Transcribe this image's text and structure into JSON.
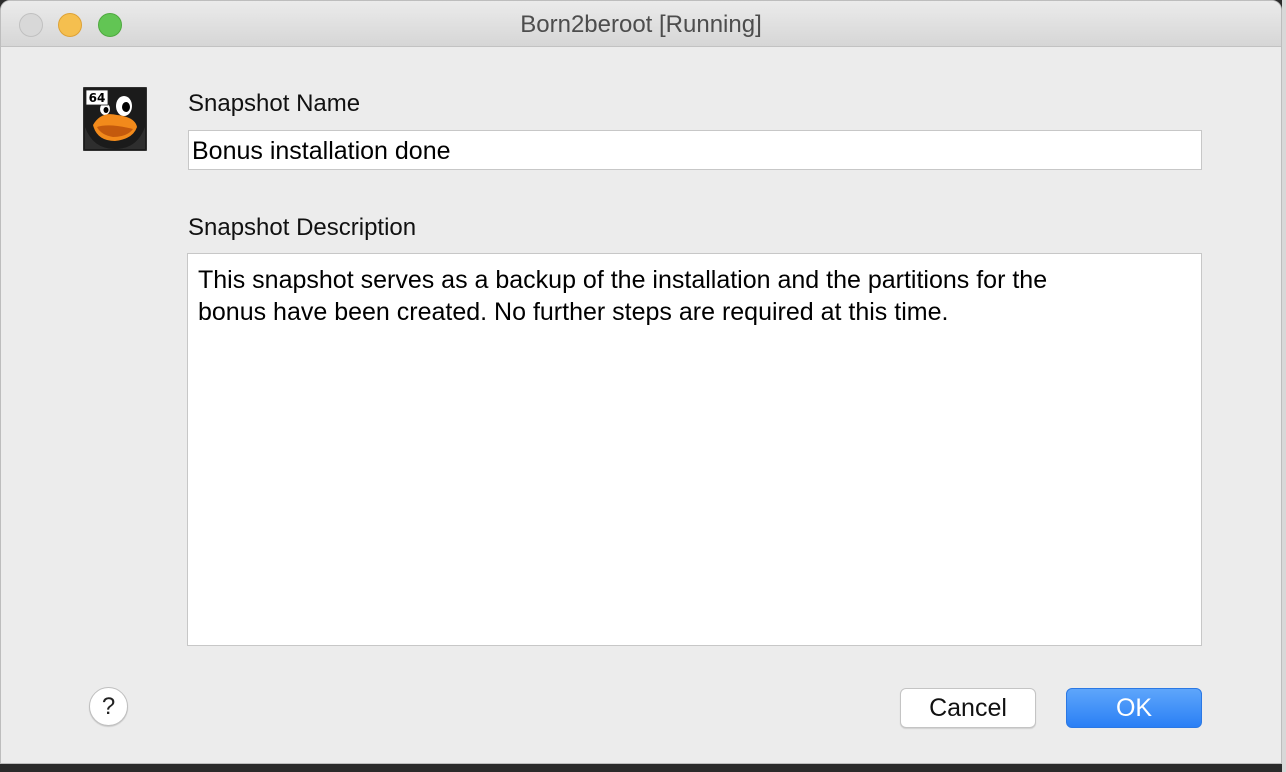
{
  "window": {
    "title": "Born2beroot [Running]"
  },
  "vm_icon": {
    "badge": "64",
    "name": "linux-tux-icon"
  },
  "form": {
    "name_label": "Snapshot Name",
    "name_value": "Bonus installation done",
    "description_label": "Snapshot Description",
    "description_value": "This snapshot serves as a backup of the installation and the partitions for the\nbonus have been created. No further steps are required at this time."
  },
  "buttons": {
    "help": "?",
    "cancel": "Cancel",
    "ok": "OK"
  },
  "colors": {
    "accent": "#2a7ff5",
    "close": "#d8d8d8",
    "minimize": "#f5bf4f",
    "zoom": "#62c554"
  }
}
